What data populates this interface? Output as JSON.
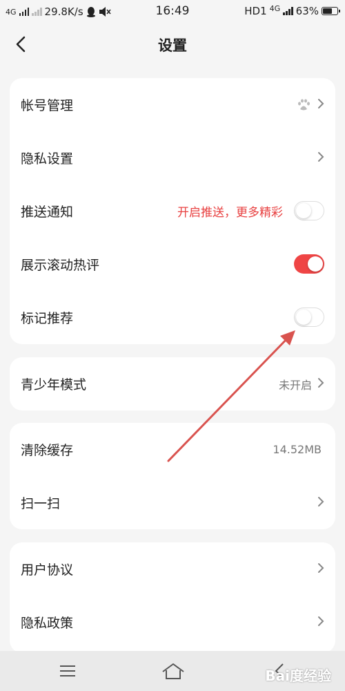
{
  "status_bar": {
    "network_left": "4G",
    "speed": "29.8K/s",
    "time": "16:49",
    "hd": "HD1",
    "network_right": "4G",
    "battery": "63%"
  },
  "nav": {
    "title": "设置"
  },
  "card1": {
    "account": {
      "label": "帐号管理"
    },
    "privacy_settings": {
      "label": "隐私设置"
    },
    "push": {
      "label": "推送通知",
      "promo": "开启推送，更多精彩",
      "enabled": false
    },
    "hot_comments": {
      "label": "展示滚动热评",
      "enabled": true
    },
    "mark_recommend": {
      "label": "标记推荐",
      "enabled": false
    }
  },
  "card2": {
    "teen_mode": {
      "label": "青少年模式",
      "value": "未开启"
    }
  },
  "card3": {
    "clear_cache": {
      "label": "清除缓存",
      "value": "14.52MB"
    },
    "scan": {
      "label": "扫一扫"
    }
  },
  "card4": {
    "user_agreement": {
      "label": "用户协议"
    },
    "privacy_policy": {
      "label": "隐私政策"
    }
  },
  "watermark": "Bai度经验",
  "colors": {
    "accent": "#ef4545",
    "promo_text": "#e84040",
    "annotation_arrow": "#d9534f"
  }
}
